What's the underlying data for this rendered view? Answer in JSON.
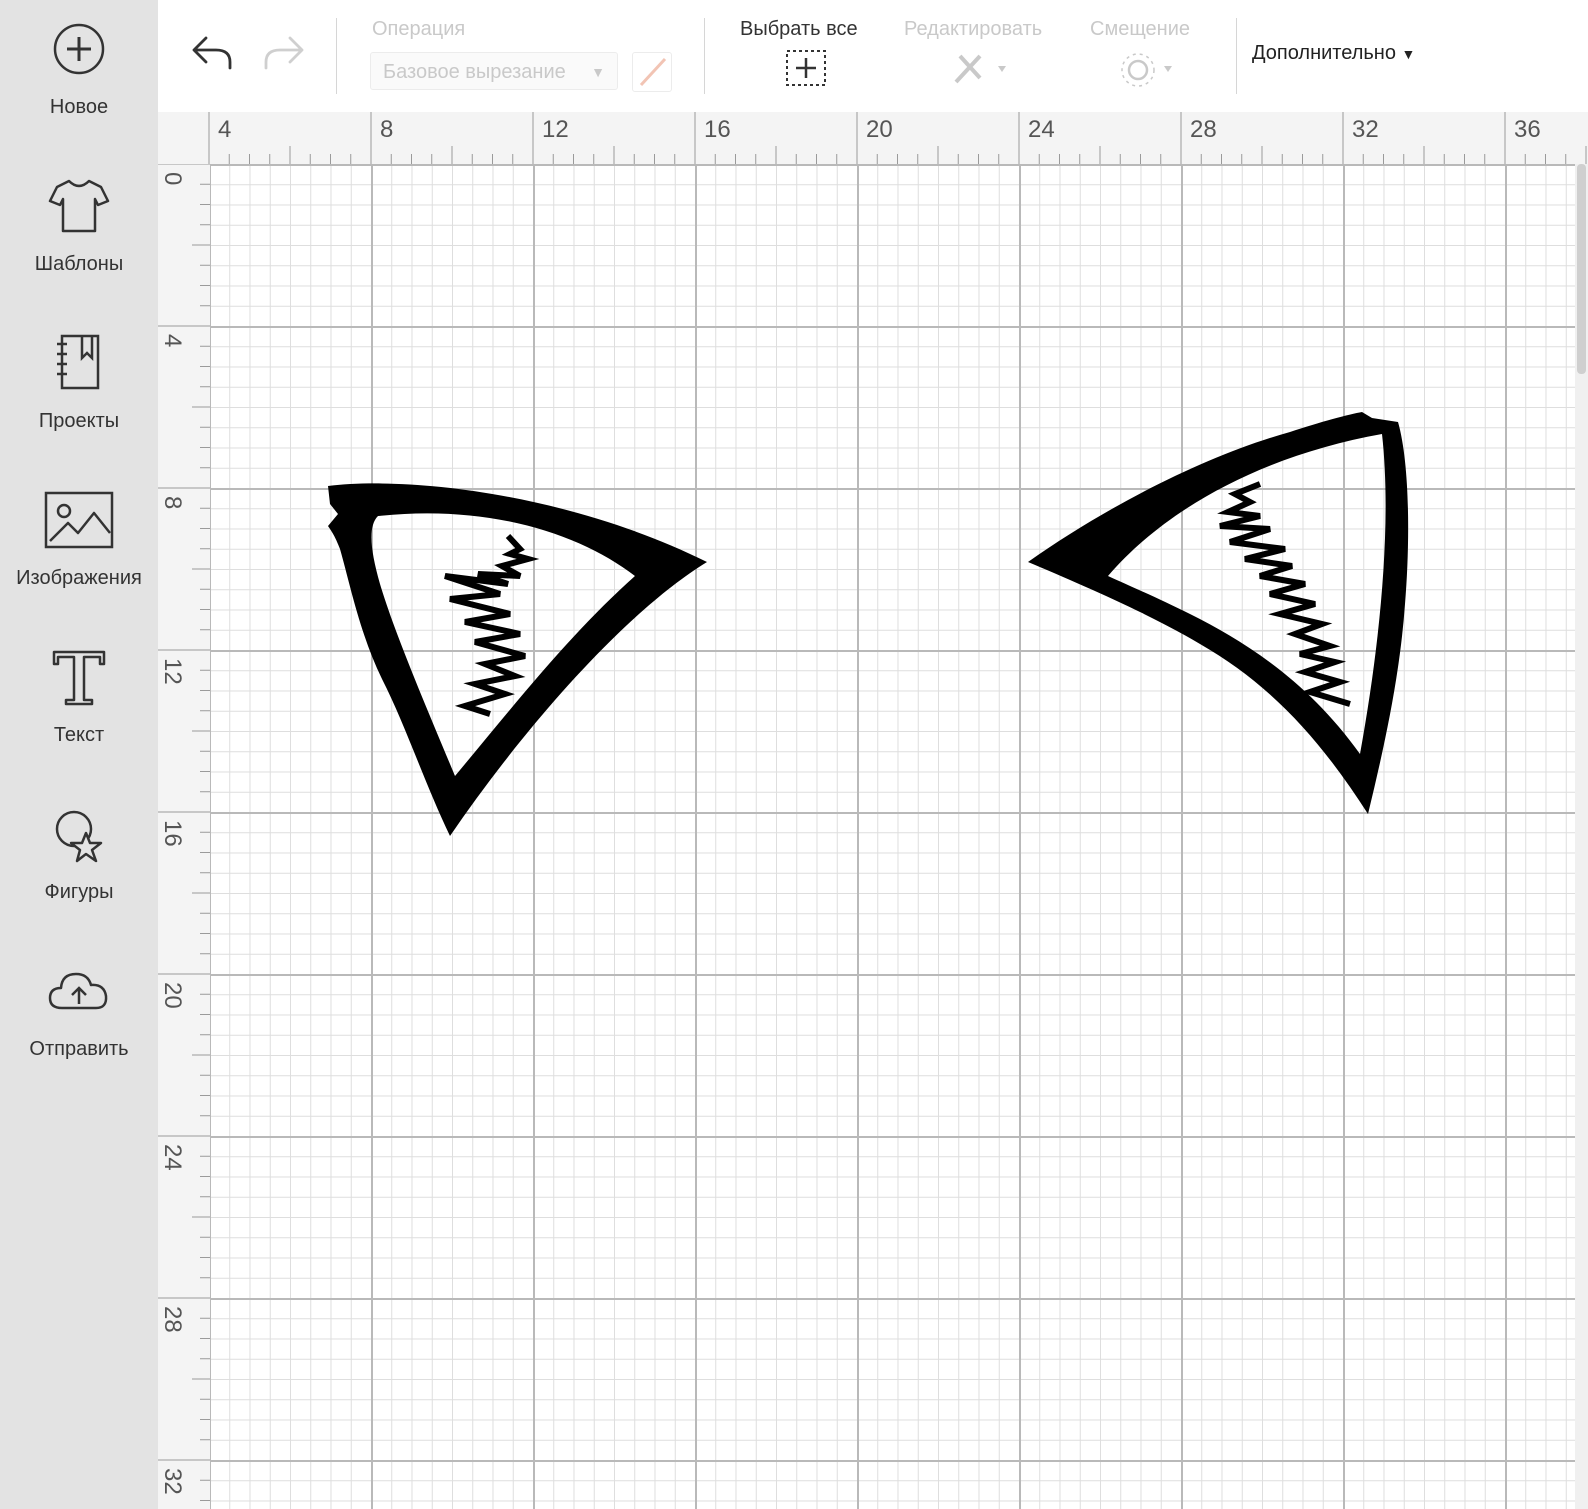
{
  "sidebar": {
    "items": [
      {
        "label": "Новое",
        "icon": "plus-circle-icon"
      },
      {
        "label": "Шаблоны",
        "icon": "tshirt-icon"
      },
      {
        "label": "Проекты",
        "icon": "notebook-icon"
      },
      {
        "label": "Изображения",
        "icon": "image-icon"
      },
      {
        "label": "Текст",
        "icon": "text-t-icon"
      },
      {
        "label": "Фигуры",
        "icon": "shapes-icon"
      },
      {
        "label": "Отправить",
        "icon": "cloud-upload-icon"
      }
    ]
  },
  "toolbar": {
    "undo_icon": "undo-icon",
    "redo_icon": "redo-icon",
    "operation_title": "Операция",
    "operation_value": "Базовое вырезание",
    "select_all_title": "Выбрать все",
    "edit_title": "Редактировать",
    "offset_title": "Смещение",
    "more_label": "Дополнительно",
    "colors": {
      "active": "#333333",
      "disabled": "#c9c9c9",
      "pen": "#f2c4b4"
    }
  },
  "rulers": {
    "top": [
      "4",
      "8",
      "12",
      "16",
      "20",
      "24",
      "28",
      "32",
      "36"
    ],
    "left": [
      "0",
      "4",
      "8",
      "12",
      "16",
      "20",
      "24",
      "28",
      "32"
    ]
  }
}
